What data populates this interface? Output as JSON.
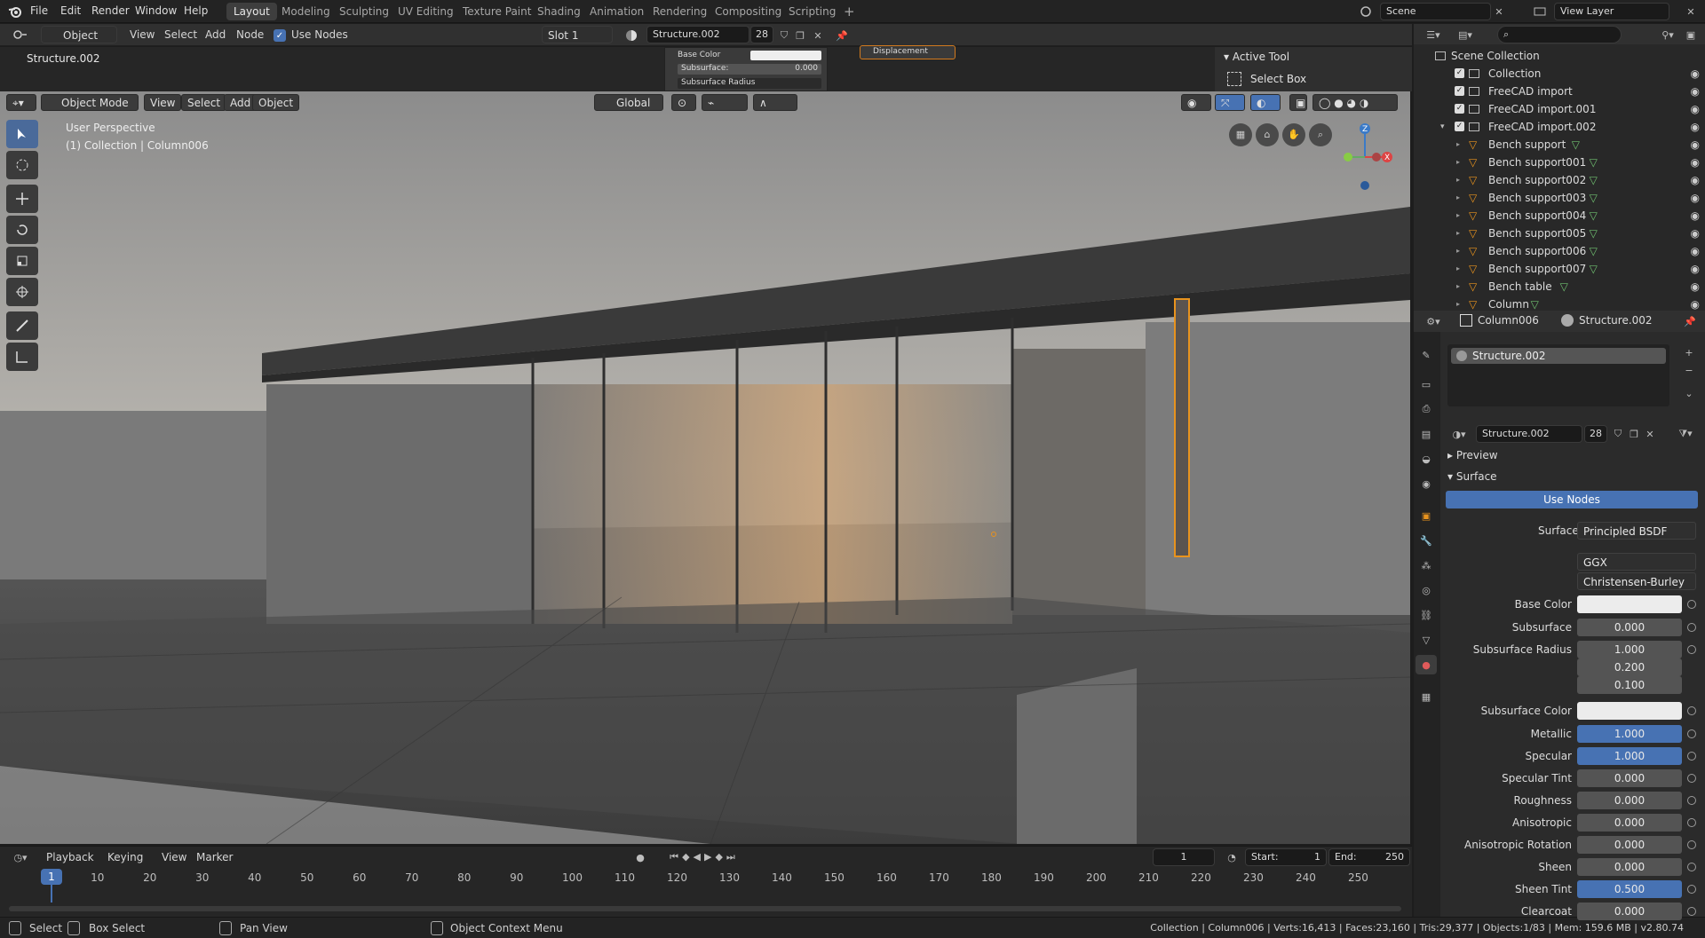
{
  "top_menu": [
    "File",
    "Edit",
    "Render",
    "Window",
    "Help"
  ],
  "workspaces": [
    {
      "label": "Layout",
      "active": true
    },
    {
      "label": "Modeling"
    },
    {
      "label": "Sculpting"
    },
    {
      "label": "UV Editing"
    },
    {
      "label": "Texture Paint"
    },
    {
      "label": "Shading"
    },
    {
      "label": "Animation"
    },
    {
      "label": "Rendering"
    },
    {
      "label": "Compositing"
    },
    {
      "label": "Scripting"
    }
  ],
  "scene": "Scene",
  "view_layer": "View Layer",
  "node_header": {
    "object": "Object",
    "view": "View",
    "select": "Select",
    "add": "Add",
    "node": "Node",
    "use_nodes": "Use Nodes",
    "slot": "Slot 1",
    "material": "Structure.002",
    "users": "28"
  },
  "node_area": {
    "title": "Structure.002",
    "base_color": "Base Color",
    "subsurface": "Subsurface:",
    "subsurface_value": "0.000",
    "subsurface_radius": "Subsurface Radius",
    "displacement": "Displacement"
  },
  "active_tool": {
    "title": "Active Tool",
    "tool": "Select Box"
  },
  "viewport": {
    "mode": "Object Mode",
    "view": "View",
    "select": "Select",
    "add": "Add",
    "object": "Object",
    "orientation": "Global",
    "perspective": "User Perspective",
    "collection_info": "(1) Collection | Column006"
  },
  "outliner": {
    "root": "Scene Collection",
    "items": [
      {
        "label": "Collection",
        "type": "collection",
        "indent": 0
      },
      {
        "label": "FreeCAD import",
        "type": "collection",
        "indent": 0
      },
      {
        "label": "FreeCAD import.001",
        "type": "collection",
        "indent": 0
      },
      {
        "label": "FreeCAD import.002",
        "type": "collection",
        "indent": 0
      },
      {
        "label": "Bench support",
        "type": "mesh",
        "indent": 1
      },
      {
        "label": "Bench support001",
        "type": "mesh",
        "indent": 1
      },
      {
        "label": "Bench support002",
        "type": "mesh",
        "indent": 1
      },
      {
        "label": "Bench support003",
        "type": "mesh",
        "indent": 1
      },
      {
        "label": "Bench support004",
        "type": "mesh",
        "indent": 1
      },
      {
        "label": "Bench support005",
        "type": "mesh",
        "indent": 1
      },
      {
        "label": "Bench support006",
        "type": "mesh",
        "indent": 1
      },
      {
        "label": "Bench support007",
        "type": "mesh",
        "indent": 1
      },
      {
        "label": "Bench table",
        "type": "mesh",
        "indent": 1
      },
      {
        "label": "Column",
        "type": "mesh",
        "indent": 1
      }
    ]
  },
  "properties": {
    "object": "Column006",
    "material": "Structure.002",
    "slot_item": "Structure.002",
    "mat_name": "Structure.002",
    "mat_users": "28",
    "preview": "Preview",
    "surface_section": "Surface",
    "use_nodes": "Use Nodes",
    "surface_label": "Surface",
    "surface_value": "Principled BSDF",
    "distribution": "GGX",
    "subsurface_method": "Christensen-Burley",
    "fields": [
      {
        "label": "Base Color",
        "value": "",
        "style": "white"
      },
      {
        "label": "Subsurface",
        "value": "0.000",
        "style": "gray"
      },
      {
        "label": "Subsurface Radius",
        "value": "1.000",
        "style": "gray"
      },
      {
        "label": "",
        "value": "0.200",
        "style": "gray"
      },
      {
        "label": "",
        "value": "0.100",
        "style": "gray"
      },
      {
        "label": "Subsurface Color",
        "value": "",
        "style": "white"
      },
      {
        "label": "Metallic",
        "value": "1.000",
        "style": "blue"
      },
      {
        "label": "Specular",
        "value": "1.000",
        "style": "blue"
      },
      {
        "label": "Specular Tint",
        "value": "0.000",
        "style": "gray"
      },
      {
        "label": "Roughness",
        "value": "0.000",
        "style": "gray"
      },
      {
        "label": "Anisotropic",
        "value": "0.000",
        "style": "gray"
      },
      {
        "label": "Anisotropic Rotation",
        "value": "0.000",
        "style": "gray"
      },
      {
        "label": "Sheen",
        "value": "0.000",
        "style": "gray"
      },
      {
        "label": "Sheen Tint",
        "value": "0.500",
        "style": "blue"
      },
      {
        "label": "Clearcoat",
        "value": "0.000",
        "style": "gray"
      }
    ]
  },
  "timeline": {
    "playback": "Playback",
    "keying": "Keying",
    "view": "View",
    "marker": "Marker",
    "current_frame": "1",
    "start_label": "Start:",
    "start": "1",
    "end_label": "End:",
    "end": "250",
    "ticks": [
      "1",
      "10",
      "20",
      "30",
      "40",
      "50",
      "60",
      "70",
      "80",
      "90",
      "100",
      "110",
      "120",
      "130",
      "140",
      "150",
      "160",
      "170",
      "180",
      "190",
      "200",
      "210",
      "220",
      "230",
      "240",
      "250"
    ]
  },
  "status": {
    "select": "Select",
    "box_select": "Box Select",
    "pan_view": "Pan View",
    "context_menu": "Object Context Menu",
    "stats": "Collection | Column006 | Verts:16,413 | Faces:23,160 | Tris:29,377 | Objects:1/83 | Mem: 159.6 MB | v2.80.74"
  },
  "colors": {
    "accent": "#4772b3",
    "selection": "#e8931e",
    "bg": "#1d1d1d"
  }
}
